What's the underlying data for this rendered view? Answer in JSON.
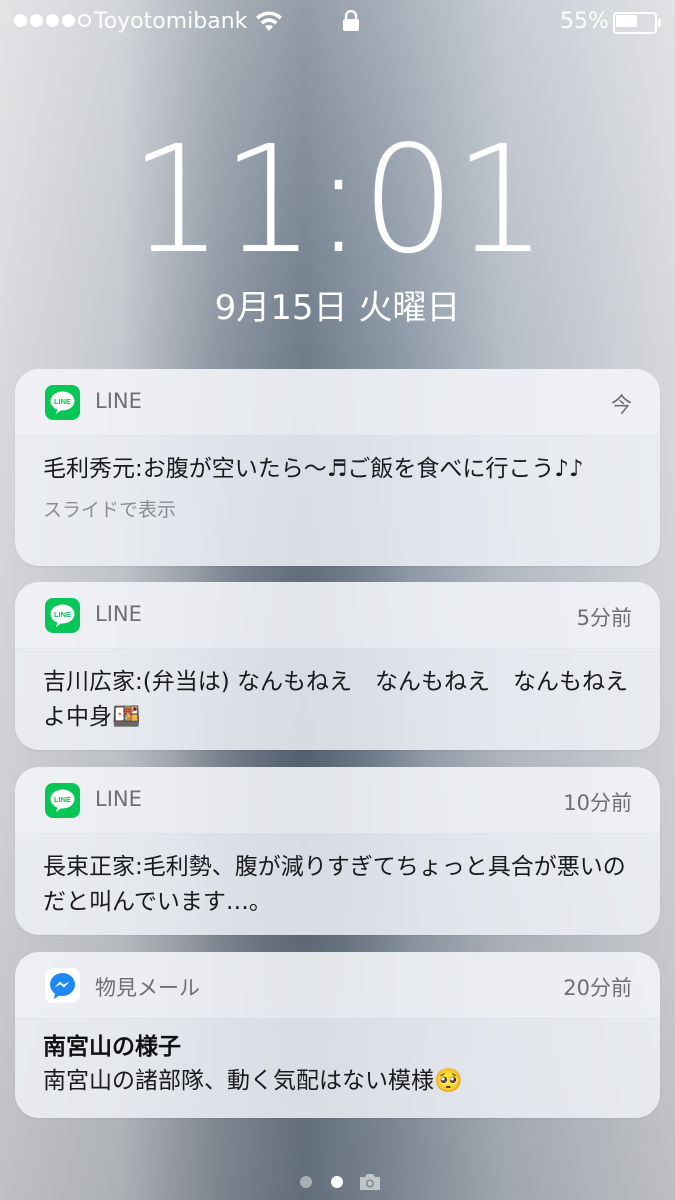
{
  "status_bar": {
    "signal_filled": 4,
    "signal_total": 5,
    "carrier": "Toyotomibank",
    "battery_text": "55%",
    "battery_level": 0.55
  },
  "lock_screen": {
    "time": "11:01",
    "date": "9月15日 火曜日"
  },
  "notifications": [
    {
      "app": "LINE",
      "icon": "line-icon",
      "time": "今",
      "message": "毛利秀元:お腹が空いたら〜♬ご飯を食べに行こう♪♪",
      "hint": "スライドで表示"
    },
    {
      "app": "LINE",
      "icon": "line-icon",
      "time": "5分前",
      "message": "吉川広家:(弁当は) なんもねえ　なんもねえ　なんもねえよ中身🍱"
    },
    {
      "app": "LINE",
      "icon": "line-icon",
      "time": "10分前",
      "message": "長束正家:毛利勢、腹が減りすぎてちょっと具合が悪いのだと叫んでいます…。"
    },
    {
      "app": "物見メール",
      "icon": "messenger-icon",
      "time": "20分前",
      "title": "南宮山の様子",
      "message": "南宮山の諸部隊、動く気配はない模様🥺"
    }
  ],
  "page_indicator": {
    "pages": 2,
    "current": 2,
    "trailing_icon": "camera-icon"
  },
  "colors": {
    "line_green": "#06C755",
    "messenger_blue": "#1E88F5"
  }
}
